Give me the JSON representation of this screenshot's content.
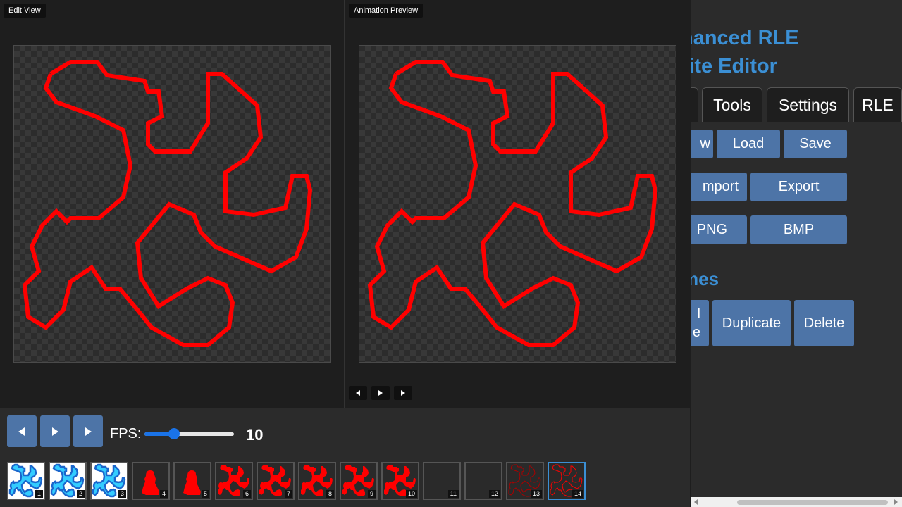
{
  "edit_view": {
    "label": "Edit View"
  },
  "animation_preview": {
    "label": "Animation Preview"
  },
  "playback": {
    "prev_icon": "step-back-icon",
    "play_icon": "play-icon",
    "next_icon": "step-forward-icon",
    "fps_label": "FPS:",
    "fps_value": "10",
    "fps_fraction": 0.33
  },
  "frames": [
    {
      "number": "1",
      "style": "blue-cross"
    },
    {
      "number": "2",
      "style": "blue-cross"
    },
    {
      "number": "3",
      "style": "blue-cross"
    },
    {
      "number": "4",
      "style": "red-figure"
    },
    {
      "number": "5",
      "style": "red-figure"
    },
    {
      "number": "6",
      "style": "red-cross"
    },
    {
      "number": "7",
      "style": "red-cross"
    },
    {
      "number": "8",
      "style": "red-cross"
    },
    {
      "number": "9",
      "style": "red-cross"
    },
    {
      "number": "10",
      "style": "red-cross"
    },
    {
      "number": "11",
      "style": "empty"
    },
    {
      "number": "12",
      "style": "empty"
    },
    {
      "number": "13",
      "style": "outline-faint"
    },
    {
      "number": "14",
      "style": "outline",
      "selected": true
    }
  ],
  "right_panel": {
    "title_line1": "hanced RLE",
    "title_line2": "rite Editor",
    "tabs": [
      "",
      "Tools",
      "Settings",
      "RLE"
    ],
    "file_buttons": {
      "new": "w",
      "load": "Load",
      "save": "Save",
      "import": "mport",
      "export": "Export",
      "png": "PNG",
      "bmp": "BMP"
    },
    "frames_section_title": "mes",
    "frame_buttons": {
      "add_line1": "l",
      "add_line2": "e",
      "duplicate": "Duplicate",
      "delete": "Delete"
    }
  },
  "colors": {
    "accent": "#3b8fd4",
    "button": "#4d74a7",
    "sprite": "#ff0000"
  }
}
